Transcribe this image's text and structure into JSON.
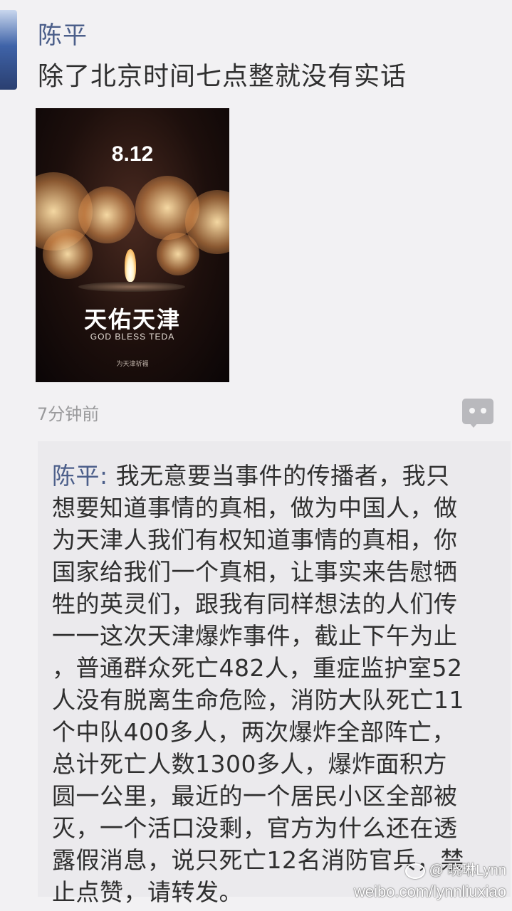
{
  "post": {
    "author": "陈平",
    "text": "除了北京时间七点整就没有实话",
    "time": "7分钟前"
  },
  "poster": {
    "date": "8.12",
    "title": "天佑天津",
    "subtitle": "GOD BLESS TEDA",
    "credit": "为天津祈福"
  },
  "comment": {
    "author_prefix": "陈平: ",
    "lines": [
      "我无意要当事件的传播者，我只",
      "想要知道事情的真相，做为中国人，做",
      "为天津人我们有权知道事情的真相，你",
      "国家给我们一个真相，让事实来告慰牺",
      "牲的英灵们，跟我有同样想法的人们传",
      "一一这次天津爆炸事件，截止下午为止",
      "，普通群众死亡482人，重症监护室52",
      "人没有脱离生命危险，消防大队死亡11",
      "个中队400多人，两次爆炸全部阵亡，",
      "总计死亡人数1300多人，爆炸面积方",
      "圆一公里，最近的一个居民小区全部被",
      "灭，一个活口没剩，官方为什么还在透",
      "露假消息，说只死亡12名消防官兵，禁",
      "止点赞，请转发。"
    ]
  },
  "watermark": {
    "user": "@ 晓琳Lynn",
    "url": "weibo.com/lynnliuxiao"
  },
  "icons": {
    "avatar": "avatar",
    "comment": "comment-icon",
    "weibo": "weibo-logo-icon"
  }
}
